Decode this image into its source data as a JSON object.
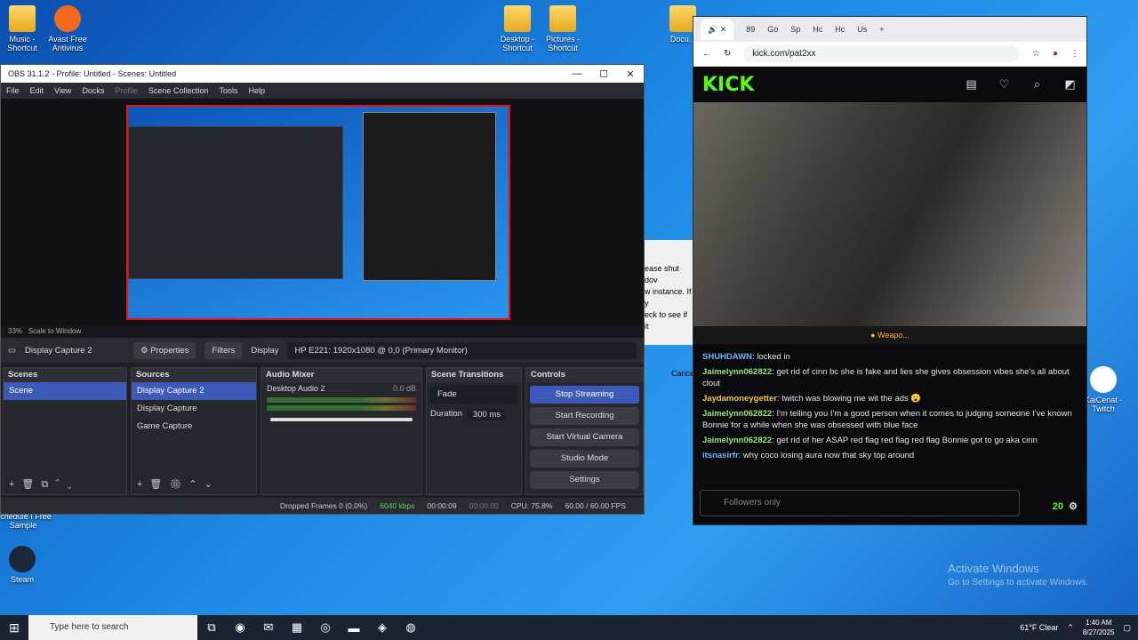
{
  "desktop": {
    "icons": [
      {
        "label": "Music - Shortcut"
      },
      {
        "label": "Avast Free Antivirus"
      },
      {
        "label": "Desktop - Shortcut"
      },
      {
        "label": "Pictures - Shortcut"
      },
      {
        "label": "Docu..."
      },
      {
        "label": "KaiCenat - Twitch"
      },
      {
        "label": "Schedule I Free Sample"
      },
      {
        "label": "Steam"
      }
    ],
    "watermark_title": "Activate Windows",
    "watermark_sub": "Go to Settings to activate Windows."
  },
  "obs": {
    "title": "OBS 31.1.2 - Profile: Untitled - Scenes: Untitled",
    "menu": [
      "File",
      "Edit",
      "View",
      "Docks",
      "Profile",
      "Scene Collection",
      "Tools",
      "Help"
    ],
    "zoom": "33%",
    "scale": "Scale to Window",
    "source_name": "Display Capture 2",
    "properties": "Properties",
    "filters": "Filters",
    "display_label": "Display",
    "display_value": "HP E221: 1920x1080 @ 0,0 (Primary Monitor)",
    "docks": {
      "scenes": "Scenes",
      "sources": "Sources",
      "mixer": "Audio Mixer",
      "transitions": "Scene Transitions",
      "controls": "Controls"
    },
    "scene": "Scene",
    "sources": [
      "Display Capture 2",
      "Display Capture",
      "Game Capture"
    ],
    "mixer_track": "Desktop Audio 2",
    "mixer_db": "0.0 dB",
    "transition": "Fade",
    "duration_label": "Duration",
    "duration": "300 ms",
    "controls": [
      "Stop Streaming",
      "Start Recording",
      "Start Virtual Camera",
      "Studio Mode",
      "Settings"
    ],
    "status": {
      "dropped": "Dropped Frames 0 (0.0%)",
      "kbps": "6040 kbps",
      "live": "00:00:09",
      "rec": "00:00:00",
      "cpu": "CPU: 75.8%",
      "fps": "60.00 / 60.00 FPS"
    }
  },
  "dialog": {
    "l1": "ease shut dov",
    "l2": "w instance. If y",
    "l3": "eck to see if it",
    "cancel": "Cance"
  },
  "browser": {
    "tabs": [
      "89",
      "Go",
      "Sp",
      "Hc",
      "Hc",
      "Us"
    ],
    "url": "kick.com/pat2xx",
    "logo": "KICK",
    "pinned": "Weapo...",
    "chat": [
      {
        "user": "SHUHDAWN",
        "color": "#6db3ff",
        "text": ": locked in"
      },
      {
        "user": "Jaimelynn062822",
        "color": "#9be37c",
        "text": ": get rid of cinn bc she is fake and lies she gives obsession vibes she's all about clout"
      },
      {
        "user": "Jaydamoneygetter",
        "color": "#f4c542",
        "text": ": twitch was blowing me wit the ads 😮"
      },
      {
        "user": "Jaimelynn062822",
        "color": "#9be37c",
        "text": ": I'm telling you I'm a good person when it comes to judging someone I've known Bonnie for a while when she was obsessed with blue face"
      },
      {
        "user": "Jaimelynn062822",
        "color": "#9be37c",
        "text": ": get rid of her ASAP red flag red flag red flag Bonnie got to go aka cinn"
      },
      {
        "user": "itsnasirfr",
        "color": "#6db3ff",
        "text": ": why coco losing aura now that sky top around"
      }
    ],
    "chat_input": "Followers only",
    "viewers": "20"
  },
  "taskbar": {
    "search": "Type here to search",
    "weather": "61°F  Clear",
    "time": "1:40 AM",
    "date": "8/27/2025"
  }
}
